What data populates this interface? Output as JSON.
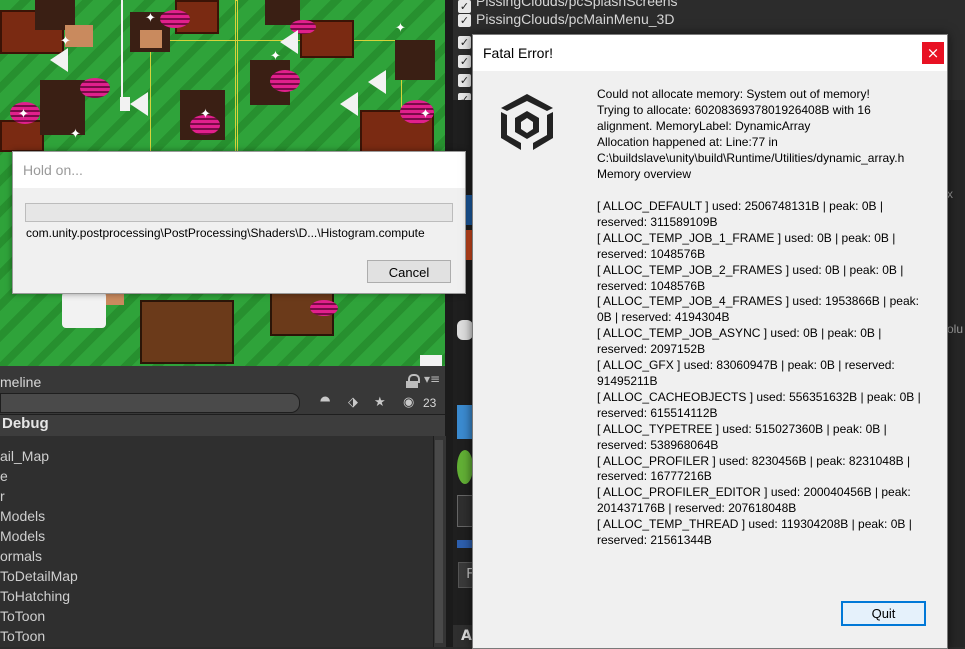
{
  "background_window": {
    "toggles": [
      {
        "label": "PissingClouds/pcSplashScreens",
        "checked": true
      },
      {
        "label": "PissingClouds/pcMainMenu_3D",
        "checked": true
      }
    ],
    "side_labels": [
      "x",
      "olu"
    ],
    "bottom_button": "F",
    "bottom_label": "A"
  },
  "timeline": {
    "label": "meline",
    "visible_count": "23",
    "menu_glyph": "▾≡"
  },
  "debug": {
    "title": "Debug",
    "items": [
      "ail_Map",
      "e",
      "r",
      "Models",
      "Models",
      "ormals",
      "ToDetailMap",
      "ToHatching",
      "ToToon",
      "ToToon"
    ]
  },
  "hold_on": {
    "title": "Hold on...",
    "progress": 0,
    "path": "com.unity.postprocessing\\PostProcessing\\Shaders\\D...\\Histogram.compute",
    "cancel_label": "Cancel"
  },
  "fatal_error": {
    "title": "Fatal Error!",
    "close_glyph": "×",
    "message_lines": [
      "Could not allocate memory: System out of memory!",
      "Trying to allocate: 6020836937801926408B with 16",
      "alignment. MemoryLabel: DynamicArray",
      "Allocation happened at: Line:77 in",
      "C:\\buildslave\\unity\\build\\Runtime/Utilities/dynamic_array.h",
      "Memory overview"
    ],
    "stats": [
      "[ ALLOC_DEFAULT ] used: 2506748131B | peak: 0B | reserved: 311589109B",
      "[ ALLOC_TEMP_JOB_1_FRAME ] used: 0B | peak: 0B | reserved: 1048576B",
      "[ ALLOC_TEMP_JOB_2_FRAMES ] used: 0B | peak: 0B | reserved: 1048576B",
      "[ ALLOC_TEMP_JOB_4_FRAMES ] used: 1953866B | peak: 0B | reserved: 4194304B",
      "[ ALLOC_TEMP_JOB_ASYNC ] used: 0B | peak: 0B | reserved: 2097152B",
      "[ ALLOC_GFX ] used: 83060947B | peak: 0B | reserved: 91495211B",
      "[ ALLOC_CACHEOBJECTS ] used: 556351632B | peak: 0B | reserved: 615514112B",
      "[ ALLOC_TYPETREE ] used: 515027360B | peak: 0B | reserved: 538968064B",
      "[ ALLOC_PROFILER ] used: 8230456B | peak: 8231048B | reserved: 16777216B",
      "[ ALLOC_PROFILER_EDITOR ] used: 200040456B | peak: 201437176B | reserved: 207618048B",
      "[ ALLOC_TEMP_THREAD ] used: 119304208B | peak: 0B | reserved: 21561344B"
    ],
    "quit_label": "Quit"
  },
  "icons": [
    "unity-logo-icon",
    "lock-icon",
    "search-icon",
    "tag-icon",
    "star-icon",
    "eye-icon",
    "checkbox-icon",
    "close-icon",
    "speaker-icon"
  ],
  "colors": {
    "progress_fill": "#06b025",
    "close_button": "#e81123",
    "quit_focus_border": "#0078d7",
    "editor_dark": "#2b2b2b",
    "grass": "#2fa33a"
  }
}
